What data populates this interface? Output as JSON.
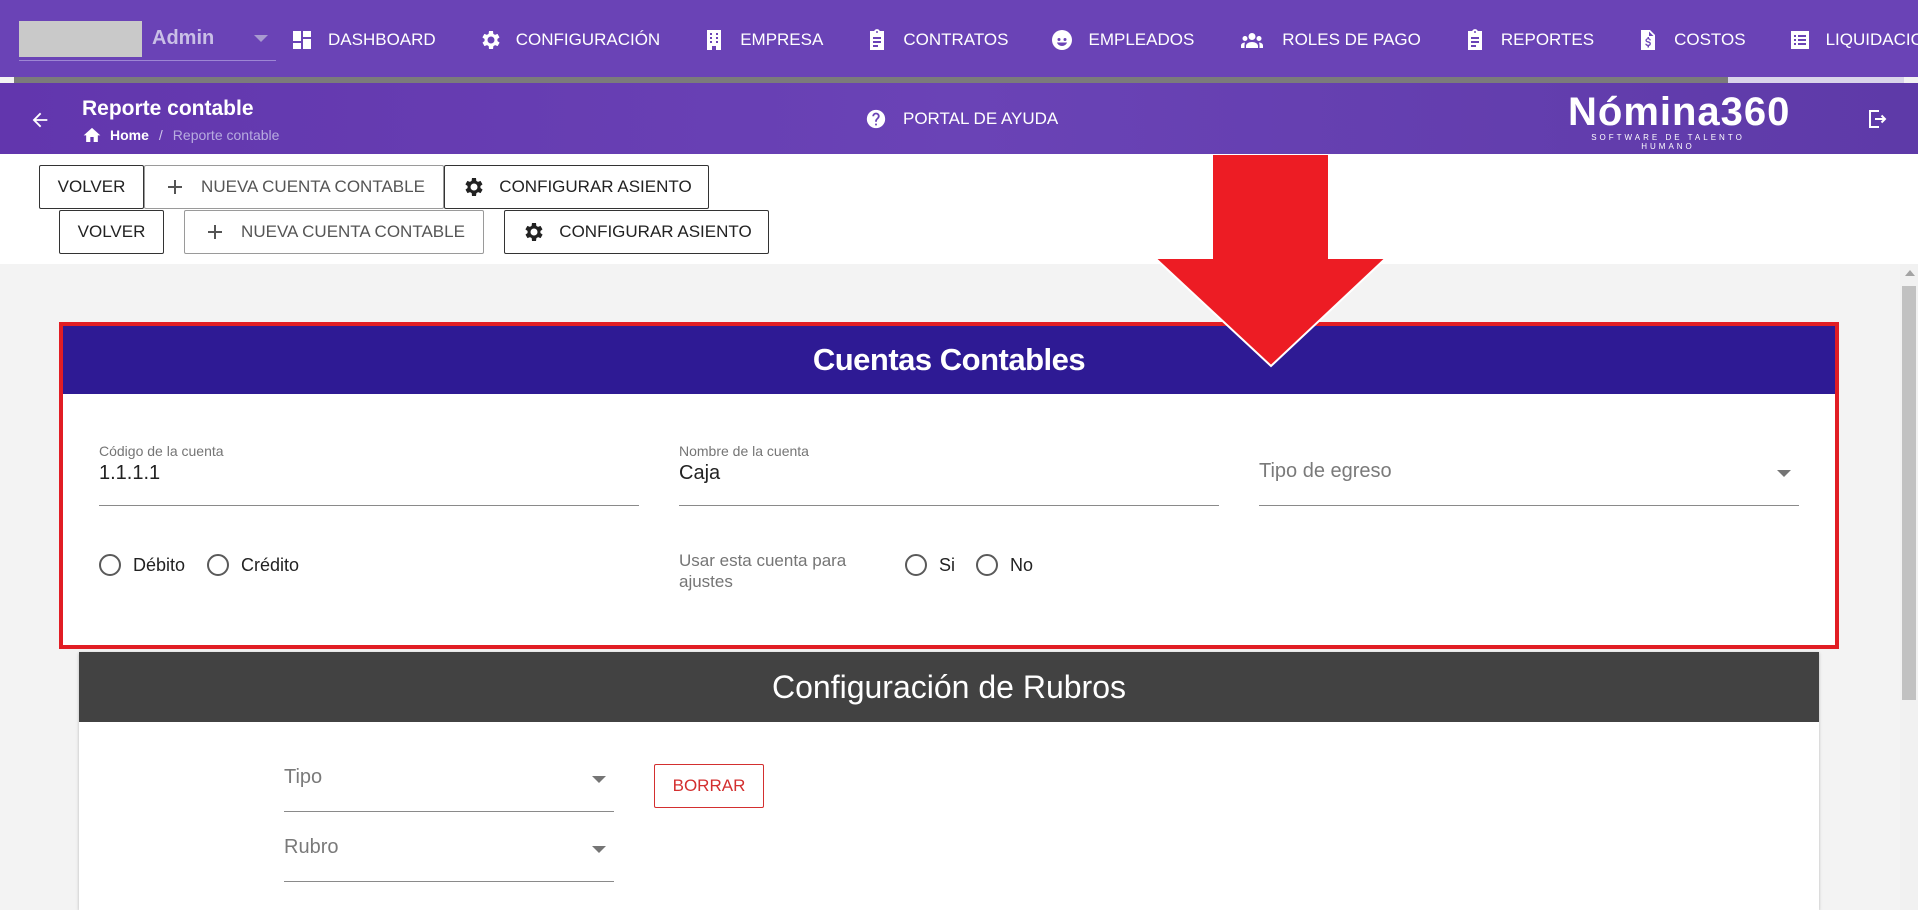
{
  "topnav": {
    "user": "Admin",
    "items": [
      {
        "label": "DASHBOARD",
        "icon": "dashboard-icon"
      },
      {
        "label": "CONFIGURACIÓN",
        "icon": "gear-icon"
      },
      {
        "label": "EMPRESA",
        "icon": "building-icon"
      },
      {
        "label": "CONTRATOS",
        "icon": "clipboard-icon"
      },
      {
        "label": "EMPLEADOS",
        "icon": "face-icon"
      },
      {
        "label": "ROLES DE PAGO",
        "icon": "people-icon"
      },
      {
        "label": "REPORTES",
        "icon": "clipboard-icon"
      },
      {
        "label": "COSTOS",
        "icon": "dollar-file-icon"
      },
      {
        "label": "LIQUIDACIONES",
        "icon": "list-icon"
      }
    ]
  },
  "subheader": {
    "title": "Reporte contable",
    "breadcrumb": {
      "home": "Home",
      "separator": "/",
      "current": "Reporte contable"
    },
    "help": "PORTAL DE AYUDA",
    "brand": {
      "name": "Nómina360",
      "tagline": "SOFTWARE DE TALENTO HUMANO"
    }
  },
  "toolbar": {
    "row1": {
      "volver": "VOLVER",
      "nueva": "NUEVA CUENTA CONTABLE",
      "configurar": "CONFIGURAR ASIENTO"
    },
    "row2": {
      "volver": "VOLVER",
      "nueva": "NUEVA CUENTA CONTABLE",
      "configurar": "CONFIGURAR ASIENTO"
    }
  },
  "cuentas": {
    "title": "Cuentas Contables",
    "codigo": {
      "label": "Código de la cuenta",
      "value": "1.1.1.1"
    },
    "nombre": {
      "label": "Nombre de la cuenta",
      "value": "Caja"
    },
    "tipo_egreso": {
      "placeholder": "Tipo de egreso"
    },
    "naturaleza": {
      "debito": "Débito",
      "credito": "Crédito"
    },
    "ajustes": {
      "question": "Usar esta cuenta para ajustes",
      "si": "Si",
      "no": "No"
    }
  },
  "rubros": {
    "title": "Configuración de Rubros",
    "tipo_placeholder": "Tipo",
    "rubro_placeholder": "Rubro",
    "borrar": "BORRAR"
  },
  "colors": {
    "nav_bg": "#6a43b6",
    "cuentas_header": "#2e1a94",
    "rubros_header": "#424242",
    "annotation": "#e11d24"
  }
}
